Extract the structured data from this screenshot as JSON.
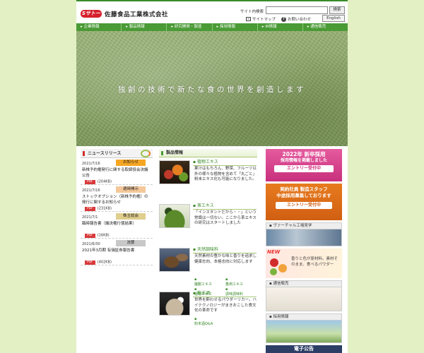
{
  "header": {
    "logo_text": "Sサトー",
    "company_name": "佐藤食品工業株式会社",
    "search_label": "サイト内検索",
    "search_button": "検索",
    "sitemap": "サイトマップ",
    "contact": "お問い合わせ",
    "english": "English"
  },
  "nav": [
    "企業情報",
    "製品情報",
    "研究開発・製造",
    "採用情報",
    "IR情報",
    "通信販売"
  ],
  "hero": {
    "tagline": "独創の技術で新たな食の世界を創造します"
  },
  "news": {
    "heading": "ニュースリリース",
    "items": [
      {
        "date": "2021/7/16",
        "badge": "お知らせ",
        "badge_color": "#f5a623",
        "title": "新株予約権発行に関する取締役会決議公告",
        "size": "(204KB)"
      },
      {
        "date": "2021/7/16",
        "badge": "適時開示",
        "badge_color": "#f4c89a",
        "title": "ストックオプション（新株予約権）の発行に関するお知らせ",
        "size": "(231KB)"
      },
      {
        "date": "2021/7/1",
        "badge": "株主総会",
        "badge_color": "#e0ce8c",
        "title": "臨時報告書（議決権行使結果）",
        "size": "(16KB)"
      },
      {
        "date": "2021/6/30",
        "badge": "決算",
        "badge_color": "#c8c8c8",
        "title": "2021年3月期 有価証券報告書",
        "size": "(402KB)"
      }
    ],
    "pdf_label": "PDF"
  },
  "products": {
    "heading": "製品情報",
    "items": [
      {
        "name": "植物エキス",
        "desc": "果汁はもちろん、野菜、フルーツ以外の様々な植物を含めて「丸ごと」粉末エキス化も可能になりました。",
        "links": []
      },
      {
        "name": "茶エキス",
        "desc": "「インスタントだから・・」という常識は一切ない。ここから茶エキスの研究はスタートしました",
        "links": []
      },
      {
        "name": "天然調味料",
        "desc": "天然素材の豊かな味と香りを追求し健康志向、本格志向に対応します",
        "links": [
          "魔動エキス",
          "畜用エキス",
          "植物エキス",
          "調味調味料"
        ]
      },
      {
        "name": "粉末酒",
        "desc": "世界を酔わせるパウダーリカー。ハイテクノロジーがまきおこした食文化の革命です",
        "links": [
          "粉末酒Q&A"
        ]
      }
    ]
  },
  "sidebar": {
    "recruit2022": {
      "year": "2022年 新卒採用",
      "line": "採用情報を掲載しました",
      "cta": "エントリー受付中"
    },
    "contract": {
      "line1": "契約社員 製造スタッフ",
      "line2": "中途採用募集しております",
      "cta": "エントリー受付中"
    },
    "factory_label": "ヴァーチャル工場見学",
    "new_badge": "NEW",
    "new_text": "香りと色が原材料。素材そのまま、食べるパウダー",
    "shop_label": "通信販売",
    "recruit_label": "採用情報",
    "ec_footer": "電子公告"
  }
}
